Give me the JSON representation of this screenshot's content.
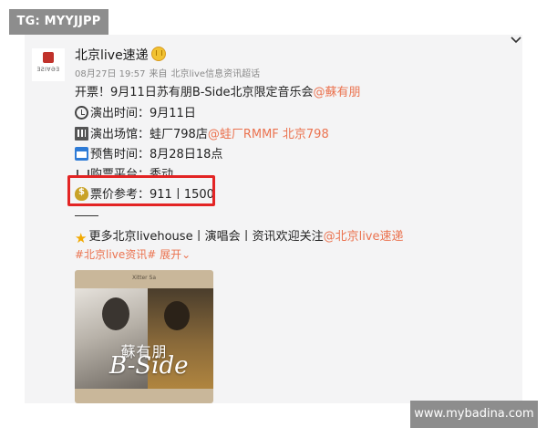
{
  "watermarks": {
    "top_left": "TG: MYYJJPP",
    "bottom_right": "www.mybadina.com"
  },
  "post": {
    "avatar_label": "ƎƧІ∀ӘƎ",
    "username": "北京live速递",
    "date": "08月27日 19:57",
    "source_prefix": "来自",
    "source": "北京live信息资讯超话",
    "title_text": "开票！9月11日苏有朋B-Side北京限定音乐会",
    "title_mention": "@蘇有朋",
    "time_label": "演出时间：9月11日",
    "venue_label": "演出场馆：蛙厂798店",
    "venue_mention": "@蛙厂RMMF 北京798",
    "presale_label": "预售时间：8月28日18点",
    "platform_label": "购票平台：秀动",
    "price_label": "票价参考：911丨1500",
    "divider_text": "——",
    "more_text": "更多北京livehouse丨演唱会丨资讯欢迎关注",
    "more_mention": "@北京live速递",
    "hashtag": "#北京live资讯#",
    "expand": "展开",
    "expand_arrow": "⌄"
  },
  "poster": {
    "top_label": "Xitter Sa",
    "artist": "蘇有朋",
    "bside": "B-Side"
  },
  "colors": {
    "mention": "#eb7350",
    "highlight": "#e32424",
    "card_bg": "#f4f4f5"
  }
}
